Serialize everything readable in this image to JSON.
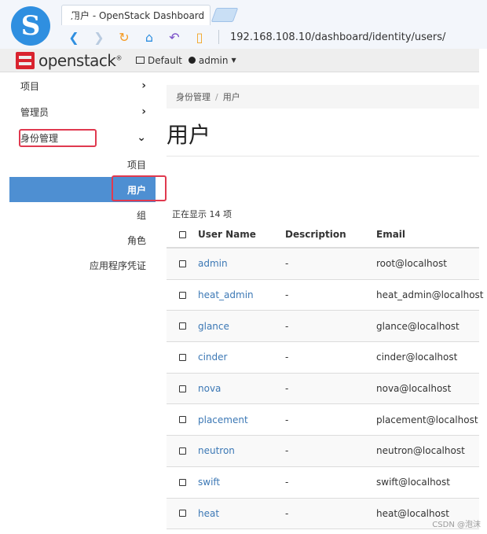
{
  "browser": {
    "tab_title": "用户 - OpenStack Dashboard",
    "tab_close": "×",
    "url": "192.168.108.10/dashboard/identity/users/",
    "logo_glyph": "S"
  },
  "header": {
    "brand": "openstack",
    "brand_mark": "®",
    "project": "Default",
    "user": "admin"
  },
  "sidebar": {
    "items": [
      {
        "label": "项目"
      },
      {
        "label": "管理员"
      },
      {
        "label": "身份管理"
      }
    ],
    "sub_items": [
      {
        "label": "项目"
      },
      {
        "label": "用户"
      },
      {
        "label": "组"
      },
      {
        "label": "角色"
      },
      {
        "label": "应用程序凭证"
      }
    ],
    "chevron_right": "›",
    "chevron_down": "⌄"
  },
  "breadcrumb": {
    "parent": "身份管理",
    "sep": "/",
    "current": "用户"
  },
  "page_title": "用户",
  "count_text": "正在显示 14 项",
  "table": {
    "columns": [
      "User Name",
      "Description",
      "Email"
    ],
    "rows": [
      {
        "name": "admin",
        "desc": "-",
        "email": "root@localhost"
      },
      {
        "name": "heat_admin",
        "desc": "-",
        "email": "heat_admin@localhost"
      },
      {
        "name": "glance",
        "desc": "-",
        "email": "glance@localhost"
      },
      {
        "name": "cinder",
        "desc": "-",
        "email": "cinder@localhost"
      },
      {
        "name": "nova",
        "desc": "-",
        "email": "nova@localhost"
      },
      {
        "name": "placement",
        "desc": "-",
        "email": "placement@localhost"
      },
      {
        "name": "neutron",
        "desc": "-",
        "email": "neutron@localhost"
      },
      {
        "name": "swift",
        "desc": "-",
        "email": "swift@localhost"
      },
      {
        "name": "heat",
        "desc": "-",
        "email": "heat@localhost"
      }
    ]
  },
  "watermark": "CSDN @泡沫",
  "colors": {
    "accent": "#4e8fd2",
    "link": "#3c78b5",
    "brand_red": "#d9232e",
    "highlight": "#e0394f"
  }
}
